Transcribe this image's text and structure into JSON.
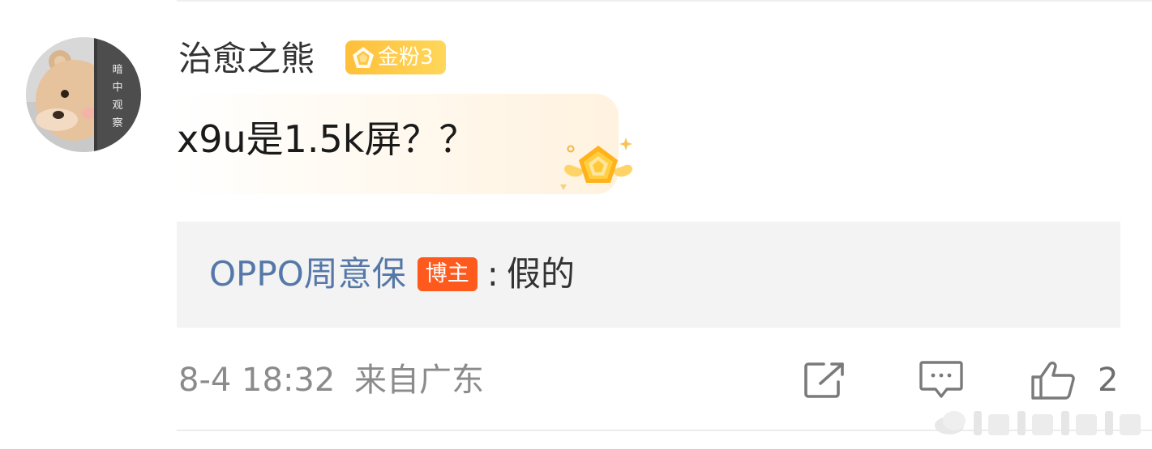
{
  "comment": {
    "username": "治愈之熊",
    "fan_badge": "金粉3",
    "text": "x9u是1.5k屏？？",
    "avatar_text": [
      "暗",
      "中",
      "观",
      "察"
    ]
  },
  "reply": {
    "author": "OPPO周意保",
    "badge": "博主",
    "colon": ":",
    "content": "假的"
  },
  "meta": {
    "time": "8-4 18:32",
    "location": "来自广东",
    "like_count": "2"
  },
  "icons": {
    "share": "share-icon",
    "comment": "comment-icon",
    "like": "thumbs-up-icon",
    "medal": "medal-icon",
    "fan_badge": "diamond-icon"
  },
  "colors": {
    "reply_author": "#5578a8",
    "blogger_badge": "#ff5a1e",
    "fan_badge": "#ffc33f",
    "reply_background": "#f3f3f3",
    "meta_text": "#8b8b8b"
  }
}
